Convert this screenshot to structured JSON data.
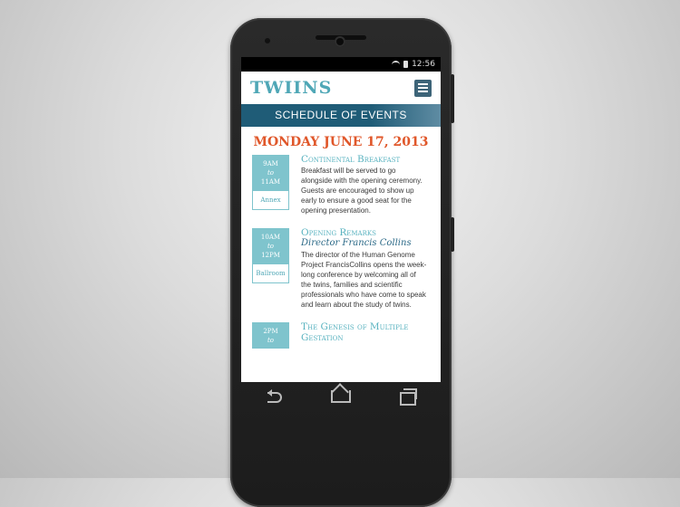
{
  "status": {
    "time": "12:56"
  },
  "app": {
    "logo": "TWIINS"
  },
  "banner": "SCHEDULE OF EVENTS",
  "date": "MONDAY JUNE 17, 2013",
  "events": [
    {
      "time_start": "9AM",
      "to": "to",
      "time_end": "11AM",
      "room": "Annex",
      "title": "Continental Breakfast",
      "subtitle": "",
      "body": "Breakfast will be served to go alongside with the opening ceremony. Guests are encouraged to show up early to ensure a good seat for the opening presentation."
    },
    {
      "time_start": "10AM",
      "to": "to",
      "time_end": "12PM",
      "room": "Ballroom",
      "title": "Opening Remarks",
      "subtitle": "Director Francis Collins",
      "body": "The director of the Human Genome Project FrancisCollins opens the week-long conference by welcoming all of the twins, families and scientific professionals who have come to speak and learn about the study of twins."
    },
    {
      "time_start": "2PM",
      "to": "to",
      "time_end": "",
      "room": "",
      "title": "The Genesis of Multiple Gestation",
      "subtitle": "",
      "body": ""
    }
  ],
  "icons": {
    "wifi": "wifi-icon",
    "battery": "battery-icon",
    "menu": "hamburger-menu-icon",
    "back": "back-icon",
    "home": "home-icon",
    "recent": "recent-apps-icon"
  },
  "colors": {
    "accent": "#4fa7b6",
    "banner": "#1f5c77",
    "date": "#e0572a"
  }
}
